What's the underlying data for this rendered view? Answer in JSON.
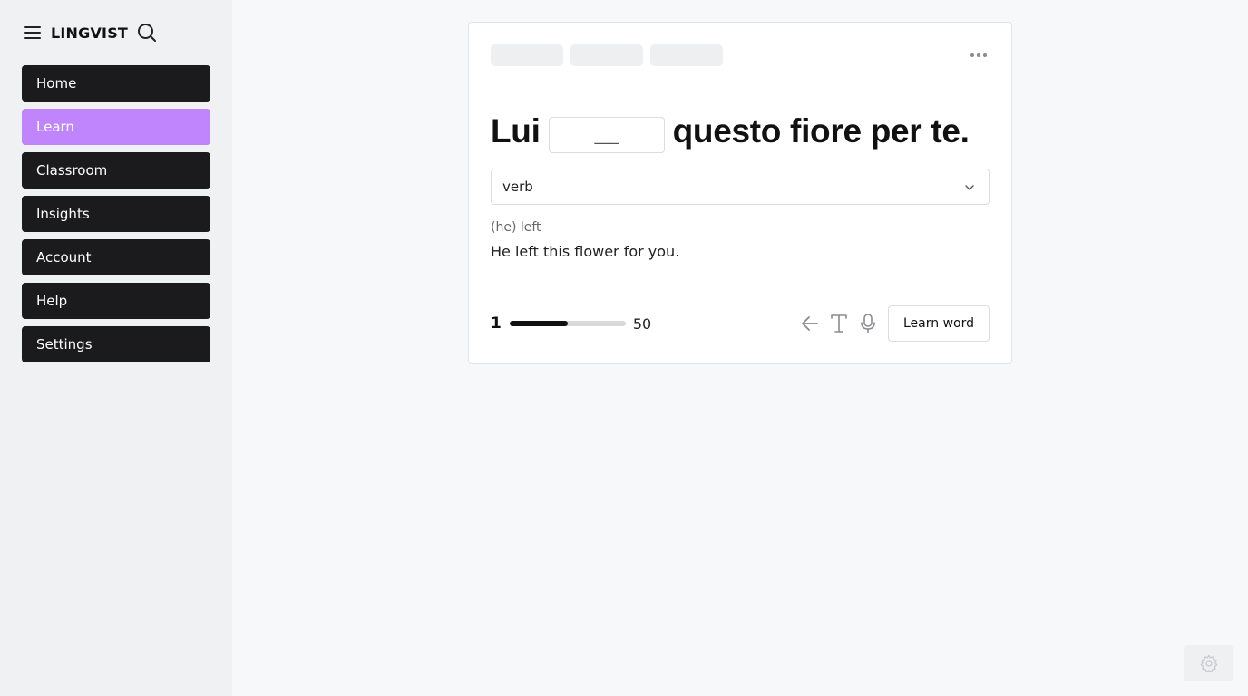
{
  "app": {
    "brand": "LINGVIST",
    "icons": {
      "menu": "hamburger-icon",
      "search": "search-icon",
      "more": "more-horizontal-icon",
      "back": "arrow-left-icon",
      "text": "text-T-icon",
      "mic": "microphone-icon",
      "settings": "gear-icon",
      "chevron": "chevron-down-icon"
    },
    "colors": {
      "nav_bg": "#1b1b1d",
      "nav_active_bg": "#c084fc",
      "page_bg": "#f7f8fa",
      "sidebar_bg": "#f0f1f3"
    }
  },
  "sidebar": {
    "items": [
      {
        "label": "Home"
      },
      {
        "label": "Learn"
      },
      {
        "label": "Classroom"
      },
      {
        "label": "Insights"
      },
      {
        "label": "Account"
      },
      {
        "label": "Help"
      },
      {
        "label": "Settings"
      }
    ],
    "active": "Learn"
  },
  "card": {
    "sentence": {
      "before": "Lui",
      "blank_placeholder": "___",
      "after": "questo fiore per te."
    },
    "word_type": "verb",
    "translation_word": "(he) left",
    "translation_sentence": "He left this flower for you.",
    "progress": {
      "current": "1",
      "total": "50",
      "fill_fraction": 0.5
    },
    "learn_word_label": "Learn word"
  }
}
